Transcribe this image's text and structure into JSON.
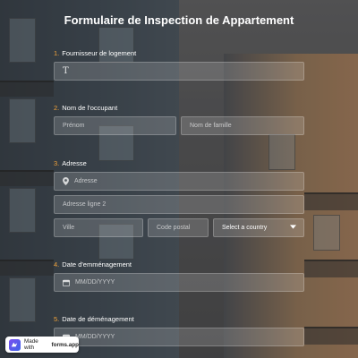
{
  "form": {
    "title": "Formulaire de Inspection de Appartement",
    "questions": [
      {
        "number": "1.",
        "label": "Fournisseur de logement"
      },
      {
        "number": "2.",
        "label": "Nom de l'occupant"
      },
      {
        "number": "3.",
        "label": "Adresse"
      },
      {
        "number": "4.",
        "label": "Date d'emménagement"
      },
      {
        "number": "5.",
        "label": "Date de déménagement"
      }
    ],
    "q1": {
      "value": "T"
    },
    "q2": {
      "first_placeholder": "Prénom",
      "last_placeholder": "Nom de famille"
    },
    "q3": {
      "address_placeholder": "Adresse",
      "address2_placeholder": "Adresse ligne 2",
      "city_placeholder": "Ville",
      "postal_placeholder": "Code postal",
      "country_value": "Select a country"
    },
    "q4": {
      "date_placeholder": "MM/DD/YYYY"
    },
    "q5": {
      "date_placeholder": "MM/DD/YYYY"
    }
  },
  "badge": {
    "prefix": "Made with",
    "brand": "forms.app"
  },
  "icons": {
    "address": "location-pin-icon",
    "date": "calendar-icon",
    "dropdown": "chevron-down-icon",
    "brand": "forms-app-logo-icon"
  },
  "colors": {
    "number_accent": "#f2a33a",
    "badge_logo": "#6a55ee"
  }
}
